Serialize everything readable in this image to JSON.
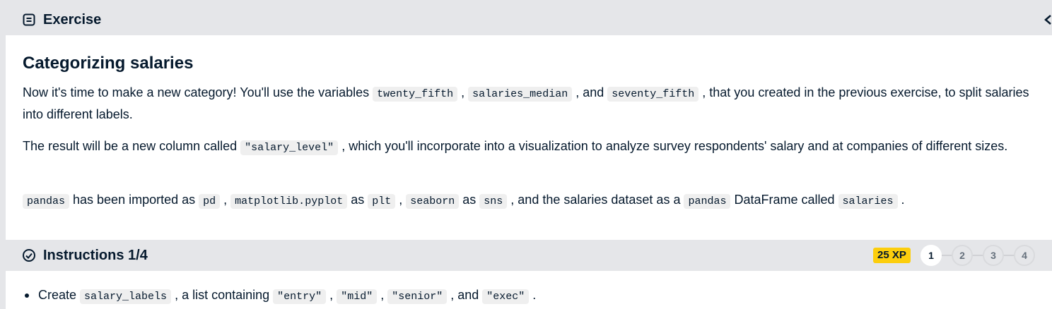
{
  "exercise_bar": {
    "title": "Exercise",
    "icon": "document-icon"
  },
  "exercise": {
    "title": "Categorizing salaries",
    "p1": [
      "Now it's time to make a new category! You'll use the variables ",
      "twenty_fifth",
      " , ",
      "salaries_median",
      " , and ",
      "seventy_fifth",
      " , that you created in the previous exercise, to split salaries into different labels."
    ],
    "p2": [
      "The result will be a new column called ",
      "\"salary_level\"",
      " , which you'll incorporate into a visualization to analyze survey respondents' salary and at companies of different sizes."
    ],
    "p3": [
      "pandas",
      " has been imported as ",
      "pd",
      " , ",
      "matplotlib.pyplot",
      " as ",
      "plt",
      " , ",
      "seaborn",
      " as ",
      "sns",
      " , and the salaries dataset as a ",
      "pandas",
      " DataFrame called ",
      "salaries",
      " ."
    ]
  },
  "instructions_bar": {
    "title": "Instructions 1/4",
    "icon": "check-circle-icon",
    "xp": "25 XP",
    "steps": [
      "1",
      "2",
      "3",
      "4"
    ],
    "active_step": "1"
  },
  "instructions": {
    "bullet1": [
      "Create ",
      "salary_labels",
      " , a list containing ",
      "\"entry\"",
      " , ",
      "\"mid\"",
      " , ",
      "\"senior\"",
      " , and ",
      "\"exec\"",
      " ."
    ]
  },
  "colors": {
    "bar_bg": "#e5e6e9",
    "xp_yellow": "#fcce0d",
    "text": "#05192d",
    "code_bg": "#efefef"
  }
}
